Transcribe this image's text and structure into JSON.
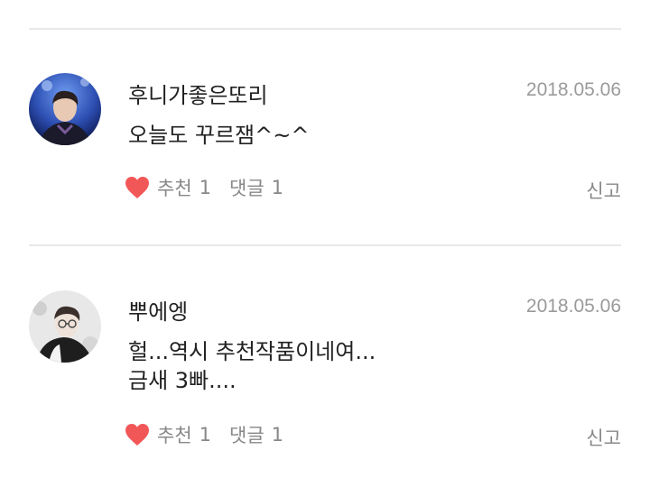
{
  "accent": {
    "heart": "#f25757",
    "divider": "#e9e9e9"
  },
  "comments": [
    {
      "username": "후니가좋은또리",
      "date": "2018.05.06",
      "lines": [
        "오늘도 꾸르잼^~^"
      ],
      "like_label": "추천",
      "like_count": "1",
      "reply_label": "댓글",
      "reply_count": "1",
      "report_label": "신고"
    },
    {
      "username": "뿌에엥",
      "date": "2018.05.06",
      "lines": [
        "헐...역시 추천작품이네여...",
        "금새 3빠...."
      ],
      "like_label": "추천",
      "like_count": "1",
      "reply_label": "댓글",
      "reply_count": "1",
      "report_label": "신고"
    }
  ]
}
